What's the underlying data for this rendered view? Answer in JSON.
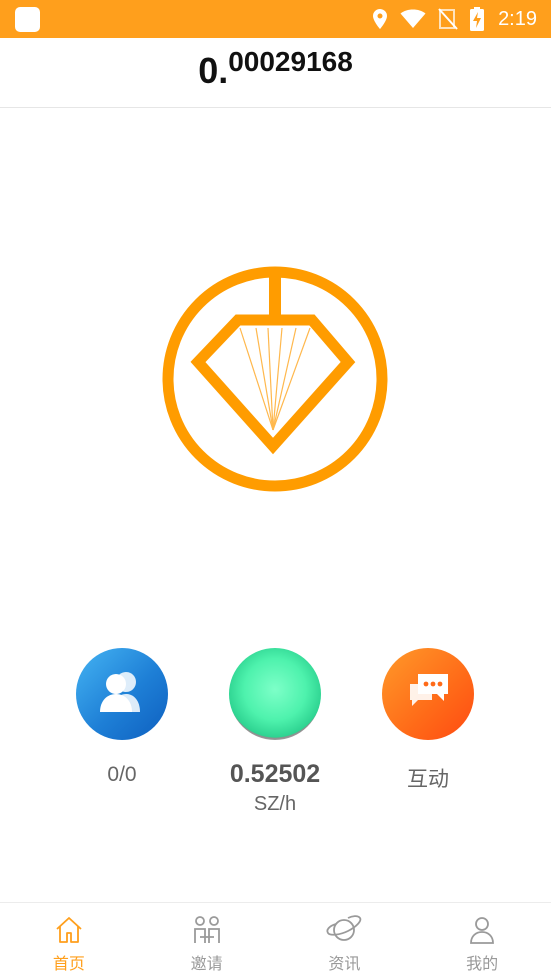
{
  "status_bar": {
    "time": "2:19",
    "icons": [
      "location-icon",
      "wifi-icon",
      "no-signal-icon",
      "battery-charging-icon"
    ],
    "color": "#ff9f1c"
  },
  "header": {
    "balance_int": "0.",
    "balance_frac": "00029168"
  },
  "logo": {
    "icon": "diamond-coin-logo",
    "color": "#ff9c00"
  },
  "actions": {
    "team": {
      "icon": "users-icon",
      "label": "0/0"
    },
    "mine": {
      "icon": "mining-orb-icon",
      "rate": "0.52502",
      "unit": "SZ/h"
    },
    "chat": {
      "icon": "chat-bubbles-icon",
      "label": "互动"
    }
  },
  "bottom_nav": {
    "active_color": "#ff9f1c",
    "items": [
      {
        "label": "首页",
        "icon": "home-icon",
        "active": true
      },
      {
        "label": "邀请",
        "icon": "invite-icon",
        "active": false
      },
      {
        "label": "资讯",
        "icon": "planet-icon",
        "active": false
      },
      {
        "label": "我的",
        "icon": "profile-icon",
        "active": false
      }
    ]
  }
}
